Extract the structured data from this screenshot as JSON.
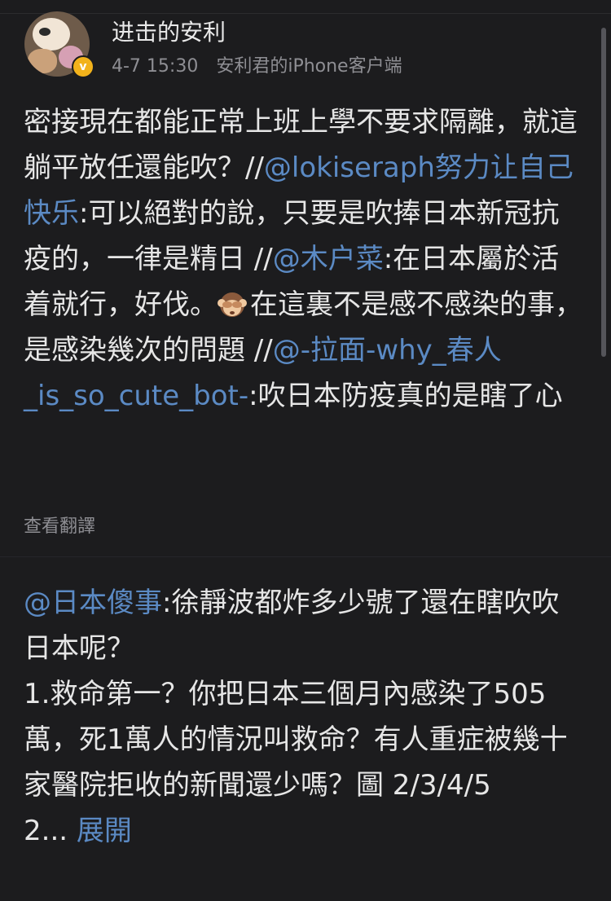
{
  "post": {
    "username": "进击的安利",
    "time": "4-7 15:30",
    "client": "安利君的iPhone客户端",
    "repost_segments": [
      {
        "type": "text",
        "text": "密接現在都能正常上班上學不要求隔離，就這躺平放任還能吹？//"
      },
      {
        "type": "mention",
        "text": "@lokiseraph努力让自己快乐"
      },
      {
        "type": "text",
        "text": ":可以絕對的說，只要是吹捧日本新冠抗疫的，一律是精日 //"
      },
      {
        "type": "mention",
        "text": "@木户菜"
      },
      {
        "type": "text",
        "text": ":在日本屬於活着就行，好伐。"
      },
      {
        "type": "emoji",
        "name": "see-no-evil-monkey-icon"
      },
      {
        "type": "text",
        "text": "在這裏不是感不感染的事，是感染幾次的問題 //"
      },
      {
        "type": "mention",
        "text": "@-拉面-why_春人_is_so_cute_bot-"
      },
      {
        "type": "text",
        "text": ":吹日本防疫真的是瞎了心"
      }
    ],
    "translate_label": "查看翻譯",
    "original_mention": "@日本傻事",
    "original_lines": [
      ":徐靜波都炸多少號了還在瞎吹吹日本呢？",
      "1.救命第一？你把日本三個月內感染了505萬，死1萬人的情況叫救命？有人重症被幾十家醫院拒收的新聞還少嗎？圖 2/3/4/5"
    ],
    "truncated_prefix": "2... ",
    "expand_label": "展開"
  },
  "colors": {
    "background": "#1c1c1e",
    "text": "#e6e6e6",
    "link": "#5b8ac4",
    "muted": "#8e8e93",
    "verified": "#f2b21b"
  }
}
